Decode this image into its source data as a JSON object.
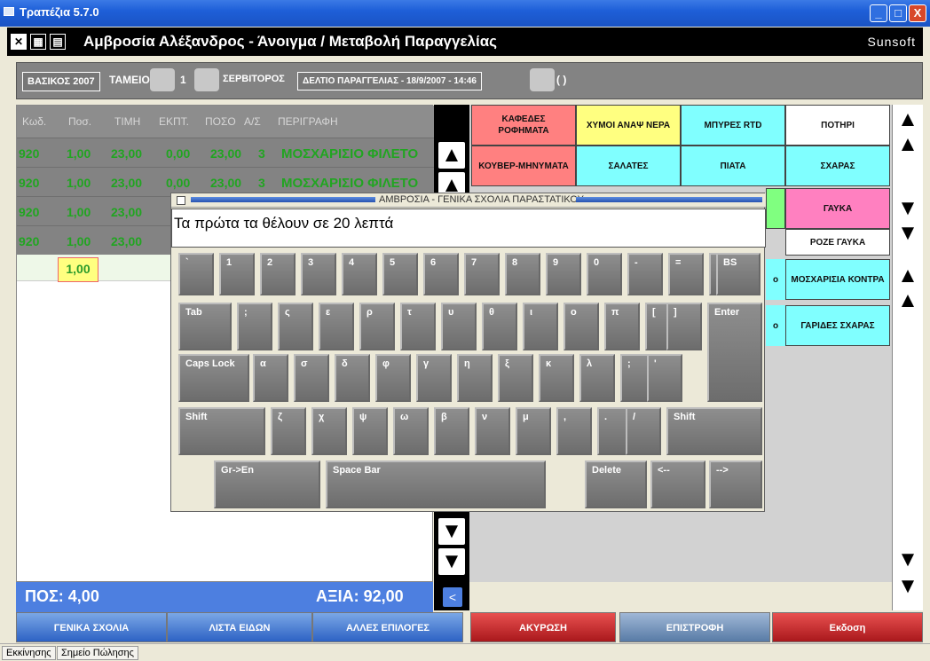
{
  "window": {
    "title": "Τραπέζια 5.7.0",
    "min": "_",
    "max": "□",
    "close": "X"
  },
  "app": {
    "title": "Αμβροσία Αλέξανδρος - Άνοιγμα / Μεταβολή Παραγγελίας",
    "brand": "Sunsoft"
  },
  "infobar": {
    "company": "ΒΑΣΙΚΟΣ 2007",
    "register_label": "ΤΑΜΕΙΟ",
    "table_no": "1",
    "waiter_label": "ΣΕΡΒΙΤΟΡΟΣ",
    "order_ticket": "ΔΕΛΤΙΟ ΠΑΡΑΓΓΕΛΙΑΣ  -  18/9/2007  -  14:46",
    "user": "( )"
  },
  "order": {
    "headers": [
      "Κωδ.",
      "Ποσ.",
      "ΤΙΜΗ",
      "ΕΚΠΤ.",
      "ΠΟΣΟ",
      "Α/Σ",
      "ΠΕΡΙΓΡΑΦΗ"
    ],
    "rows": [
      [
        "920",
        "1,00",
        "23,00",
        "0,00",
        "23,00",
        "3",
        "ΜΟΣΧΑΡΙΣΙΟ ΦΙΛΕΤΟ"
      ],
      [
        "920",
        "1,00",
        "23,00",
        "0,00",
        "23,00",
        "3",
        "ΜΟΣΧΑΡΙΣΙΟ ΦΙΛΕΤΟ"
      ],
      [
        "920",
        "1,00",
        "23,00"
      ],
      [
        "920",
        "1,00",
        "23,00"
      ]
    ],
    "new_qty": "1,00",
    "total_qty": "ΠΟΣ:  4,00",
    "total_value": "ΑΞΙΑ:  92,00"
  },
  "categories": [
    {
      "label": "ΚΑΦΕΔΕΣ ΡΟΦΗΜΑΤΑ",
      "color": "#ff8080"
    },
    {
      "label": "ΧΥΜΟΙ ΑΝΑΨ ΝΕΡΑ",
      "color": "#ffff80"
    },
    {
      "label": "ΜΠΥΡΕΣ RTD",
      "color": "#80ffff"
    },
    {
      "label": "ΠΟΤΗΡΙ",
      "color": "#ffffff"
    },
    {
      "label": "ΚΟΥΒΕΡ-ΜΗΝΥΜΑΤΑ",
      "color": "#ff8080"
    },
    {
      "label": "ΣΑΛΑΤΕΣ",
      "color": "#80ffff"
    },
    {
      "label": "ΠΙΑΤΑ",
      "color": "#80ffff"
    },
    {
      "label": "ΣΧΑΡΑΣ",
      "color": "#80ffff"
    }
  ],
  "categories2": [
    {
      "label": "ΓΑΥΚΑ",
      "color": "#ff80c0"
    },
    {
      "label": "ΡΟΖΕ ΓΑΥΚΑ",
      "color": "#ffffff"
    },
    {
      "label": "ΜΟΣΧΑΡΙΣΙΑ ΚΟΝΤΡΑ",
      "color": "#80ffff"
    },
    {
      "label": "ΓΑΡΙΔΕΣ ΣΧΑΡΑΣ",
      "color": "#80ffff"
    }
  ],
  "partial_cat_suffix": [
    "ο",
    "ο"
  ],
  "keyboard": {
    "title": "ΑΜΒΡΟΣΙΑ - ΓΕΝΙΚΑ ΣΧΟΛΙΑ ΠΑΡΑΣΤΑΤΙΚΟΥ",
    "text": "Τα πρώτα τα θέλουν σε 20 λεπτά",
    "row1": [
      "`",
      "1",
      "2",
      "3",
      "4",
      "5",
      "6",
      "7",
      "8",
      "9",
      "0",
      "-",
      "=",
      "\\",
      "BS"
    ],
    "row2": [
      "Tab",
      ";",
      "ς",
      "ε",
      "ρ",
      "τ",
      "υ",
      "θ",
      "ι",
      "ο",
      "π",
      "[",
      "]"
    ],
    "enter": "Enter",
    "row3": [
      "Caps Lock",
      "α",
      "σ",
      "δ",
      "φ",
      "γ",
      "η",
      "ξ",
      "κ",
      "λ",
      ";",
      "'"
    ],
    "row4": [
      "Shift",
      "ζ",
      "χ",
      "ψ",
      "ω",
      "β",
      "ν",
      "μ",
      ",",
      ".",
      "/",
      "Shift"
    ],
    "row5": [
      "Gr->En",
      "Space Bar",
      "Delete",
      "<--",
      "-->"
    ]
  },
  "buttons": [
    {
      "label": "ΓΕΝΙΚΑ ΣΧΟΛΙΑ",
      "style": "blue"
    },
    {
      "label": "ΛΙΣΤΑ ΕΙΔΩΝ",
      "style": "blue"
    },
    {
      "label": "ΑΛΛΕΣ ΕΠΙΛΟΓΕΣ",
      "style": "blue"
    },
    {
      "label": "ΑΚΥΡΩΣΗ",
      "style": "red"
    },
    {
      "label": "ΕΠΙΣΤΡΟΦΗ",
      "style": "steel"
    },
    {
      "label": "Εκδοση",
      "style": "red"
    }
  ],
  "status": {
    "start": "Εκκίνησης",
    "pos": "Σημείο Πώλησης"
  },
  "icons": {
    "up": "▲",
    "down": "▼",
    "left": "<"
  }
}
